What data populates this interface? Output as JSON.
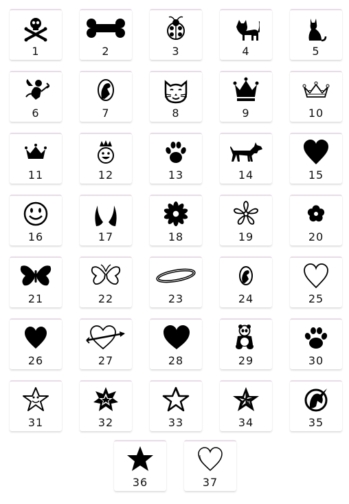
{
  "colors": {
    "ink": "#000000",
    "tile_border": "#e8dce6",
    "background": "#ffffff"
  },
  "stencils": [
    {
      "number": "1",
      "icon": "skull-crossbones"
    },
    {
      "number": "2",
      "icon": "bone"
    },
    {
      "number": "3",
      "icon": "ladybug"
    },
    {
      "number": "4",
      "icon": "cat-standing"
    },
    {
      "number": "5",
      "icon": "cat-sitting"
    },
    {
      "number": "6",
      "icon": "cupid"
    },
    {
      "number": "7",
      "icon": "cameo-dog"
    },
    {
      "number": "8",
      "icon": "cat-face"
    },
    {
      "number": "9",
      "icon": "crown-solid"
    },
    {
      "number": "10",
      "icon": "crown-outline"
    },
    {
      "number": "11",
      "icon": "crown-small"
    },
    {
      "number": "12",
      "icon": "king-smiley"
    },
    {
      "number": "13",
      "icon": "paw-print"
    },
    {
      "number": "14",
      "icon": "dog-silhouette"
    },
    {
      "number": "15",
      "icon": "heart-solid"
    },
    {
      "number": "16",
      "icon": "smiley-face"
    },
    {
      "number": "17",
      "icon": "devil-horns"
    },
    {
      "number": "18",
      "icon": "daisy-flower"
    },
    {
      "number": "19",
      "icon": "flower-outline"
    },
    {
      "number": "20",
      "icon": "flower-small"
    },
    {
      "number": "21",
      "icon": "butterfly-solid"
    },
    {
      "number": "22",
      "icon": "butterfly-outline"
    },
    {
      "number": "23",
      "icon": "halo"
    },
    {
      "number": "24",
      "icon": "cameo-dog-small"
    },
    {
      "number": "25",
      "icon": "heart-outline"
    },
    {
      "number": "26",
      "icon": "heart-solid-small"
    },
    {
      "number": "27",
      "icon": "heart-arrow"
    },
    {
      "number": "28",
      "icon": "heart-solid-wide"
    },
    {
      "number": "29",
      "icon": "panda"
    },
    {
      "number": "30",
      "icon": "paw-print-small"
    },
    {
      "number": "31",
      "icon": "star-smiley"
    },
    {
      "number": "32",
      "icon": "star-burst"
    },
    {
      "number": "33",
      "icon": "star-outline-sketch"
    },
    {
      "number": "34",
      "icon": "nautical-star"
    },
    {
      "number": "35",
      "icon": "unicorn-circle"
    },
    {
      "number": "36",
      "icon": "star-solid"
    },
    {
      "number": "37",
      "icon": "heart-outline-sketch"
    }
  ]
}
